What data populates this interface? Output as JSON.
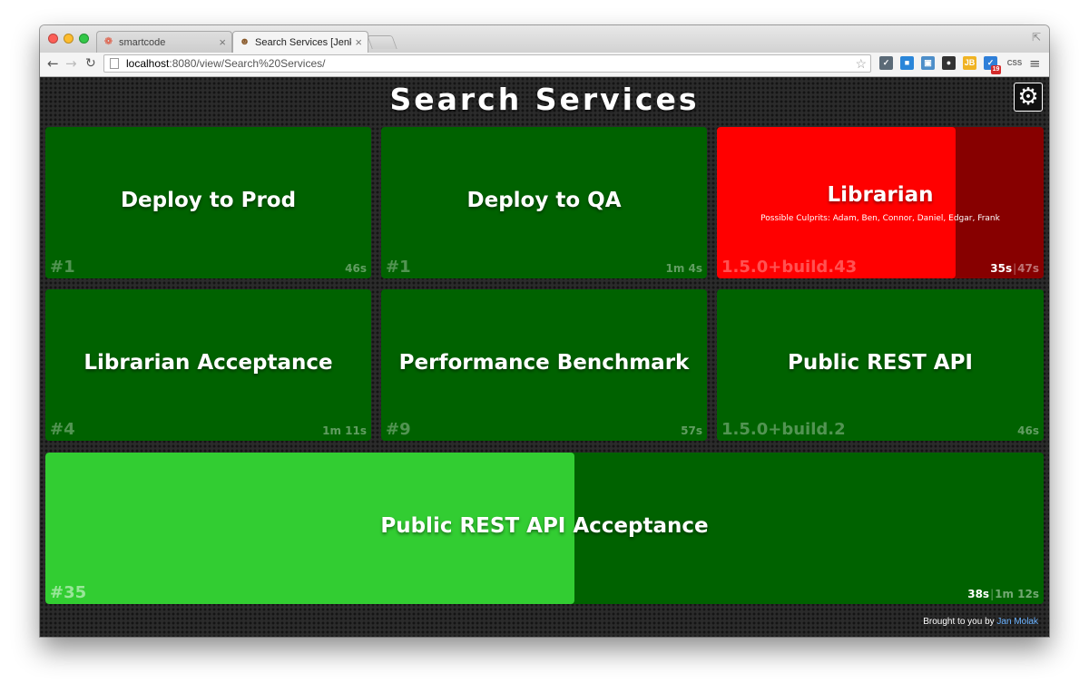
{
  "browser": {
    "tabs": [
      {
        "label": "smartcode",
        "favicon": "smartcode-swirl-icon"
      },
      {
        "label": "Search Services [Jenkins]",
        "favicon": "jenkins-butler-icon"
      }
    ],
    "url_host": "localhost",
    "url_path": ":8080/view/Search%20Services/",
    "extension_badge": "19"
  },
  "dashboard": {
    "title": "Search Services",
    "tiles": [
      {
        "name": "Deploy to Prod",
        "build": "#1",
        "duration": "46s",
        "status": "success"
      },
      {
        "name": "Deploy to QA",
        "build": "#1",
        "duration": "1m 4s",
        "status": "success"
      },
      {
        "name": "Librarian",
        "build": "1.5.0+build.43",
        "duration": "35s",
        "estimated": "47s",
        "status": "failed-building",
        "progress": 0.73,
        "culprits": "Possible Culprits: Adam,  Ben,  Connor,  Daniel,  Edgar,  Frank"
      },
      {
        "name": "Librarian Acceptance",
        "build": "#4",
        "duration": "1m 11s",
        "status": "success"
      },
      {
        "name": "Performance Benchmark",
        "build": "#9",
        "duration": "57s",
        "status": "success"
      },
      {
        "name": "Public REST API",
        "build": "1.5.0+build.2",
        "duration": "46s",
        "status": "success"
      },
      {
        "name": "Public REST API Acceptance",
        "build": "#35",
        "duration": "38s",
        "estimated": "1m 12s",
        "status": "success-building",
        "progress": 0.53
      }
    ],
    "footer_text": "Brought to you by",
    "footer_author": "Jan Molak"
  },
  "colors": {
    "success": "#006200",
    "success_progress": "#32cd32",
    "failed": "#870000",
    "failed_progress": "#ff0000",
    "background": "#2b2b2b"
  }
}
